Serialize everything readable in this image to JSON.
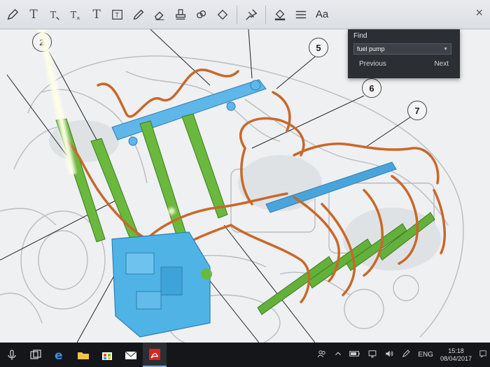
{
  "toolbar": {
    "text_tool_1": "T",
    "text_tool_2": "T",
    "text_tool_3": "T",
    "font_button": "Aa",
    "close_glyph": "×",
    "icons": [
      "pen-icon",
      "text-icon",
      "stamp-icon",
      "link-icon",
      "pin-icon",
      "fill-icon",
      "lines-icon"
    ]
  },
  "find_panel": {
    "title": "Find",
    "search_value": "fuel pump",
    "dropdown_glyph": "▼",
    "previous_label": "Previous",
    "next_label": "Next"
  },
  "callouts": [
    "2",
    "5",
    "6",
    "7"
  ],
  "taskbar": {
    "lang": "ENG",
    "time": "15:18",
    "date": "08/04/2017",
    "apps": [
      "task-view-icon",
      "edge-icon",
      "file-explorer-icon",
      "store-icon",
      "mail-icon",
      "acrobat-icon"
    ]
  },
  "colors": {
    "fuel_rail": "#5fb6e8",
    "injector": "#6ab83d",
    "fuel_line": "#c8682a",
    "pump": "#4fb3e5"
  }
}
